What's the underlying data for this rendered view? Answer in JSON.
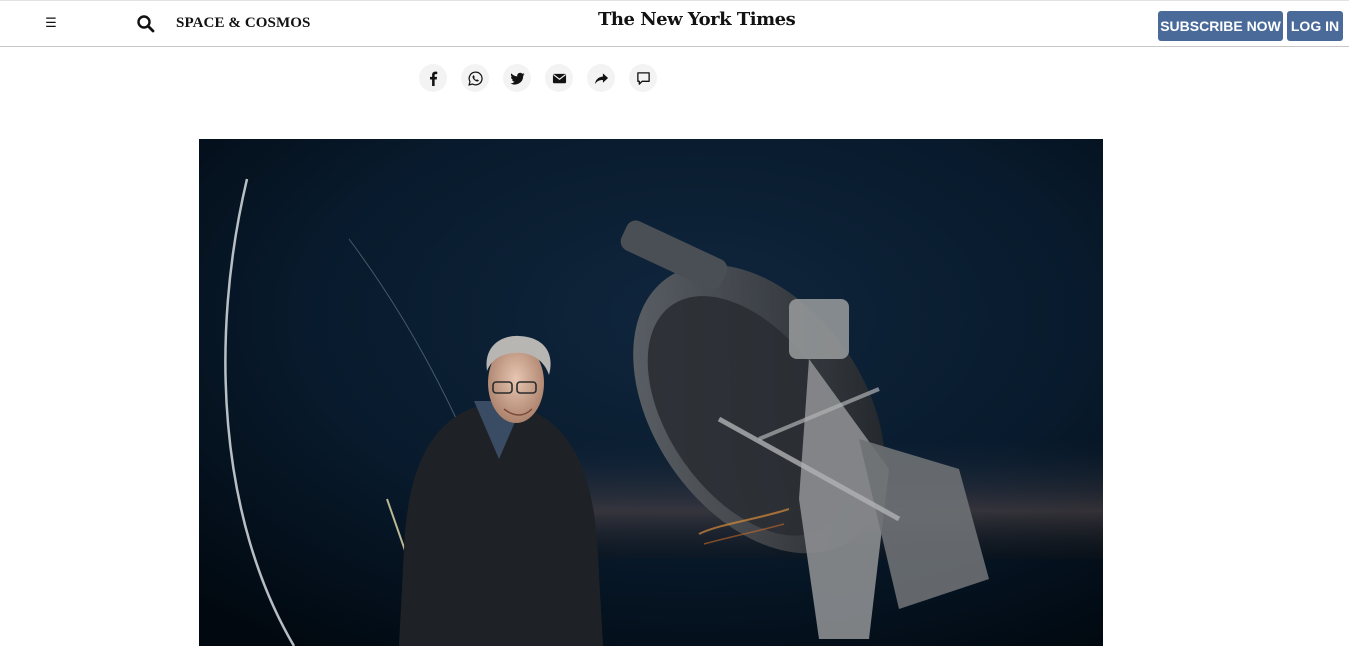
{
  "header": {
    "menu_icon": "hamburger-icon",
    "search_icon": "search-icon",
    "section": "SPACE & COSMOS",
    "logo": "The New York Times",
    "subscribe_label": "SUBSCRIBE NOW",
    "login_label": "LOG IN",
    "button_color": "#4a6a9a"
  },
  "share": {
    "icons": [
      "facebook-icon",
      "whatsapp-icon",
      "twitter-icon",
      "email-icon",
      "share-icon",
      "comment-icon"
    ]
  },
  "hero_image": {
    "subject": "photo"
  }
}
